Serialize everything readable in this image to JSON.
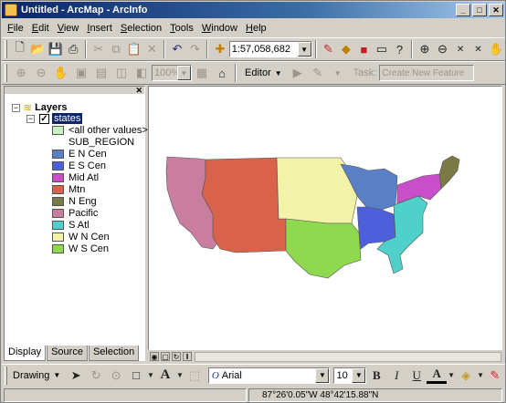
{
  "title": "Untitled - ArcMap - ArcInfo",
  "menu": [
    {
      "u": "F",
      "rest": "ile"
    },
    {
      "u": "E",
      "rest": "dit"
    },
    {
      "u": "V",
      "rest": "iew"
    },
    {
      "u": "I",
      "rest": "nsert"
    },
    {
      "u": "S",
      "rest": "election"
    },
    {
      "u": "T",
      "rest": "ools"
    },
    {
      "u": "W",
      "rest": "indow"
    },
    {
      "u": "H",
      "rest": "elp"
    }
  ],
  "toolbar": {
    "scale_value": "1:57,058,682",
    "zoom_value": "100%",
    "editor_label": "Editor",
    "task_label": "Task:",
    "task_value": "Create New Feature"
  },
  "toc": {
    "root_label": "Layers",
    "layer_label": "states",
    "other_values_label": "<all other values>",
    "field_label": "SUB_REGION",
    "legend": [
      {
        "label": "E N Cen",
        "color": "#5b7fc4"
      },
      {
        "label": "E S Cen",
        "color": "#4e5fdc"
      },
      {
        "label": "Mid Atl",
        "color": "#c94ec9"
      },
      {
        "label": "Mtn",
        "color": "#d9624b"
      },
      {
        "label": "N Eng",
        "color": "#7a7a45"
      },
      {
        "label": "Pacific",
        "color": "#c97ea0"
      },
      {
        "label": "S Atl",
        "color": "#4fd1c9"
      },
      {
        "label": "W N Cen",
        "color": "#f2f2a8"
      },
      {
        "label": "W S Cen",
        "color": "#8ed94e"
      }
    ],
    "other_values_color": "#c8f0c0",
    "tabs": [
      "Display",
      "Source",
      "Selection"
    ]
  },
  "draw": {
    "drawing_label": "Drawing",
    "font_value": "Arial",
    "size_value": "10"
  },
  "status": {
    "coordinates": "87°26'0.05\"W  48°42'15.88\"N"
  }
}
